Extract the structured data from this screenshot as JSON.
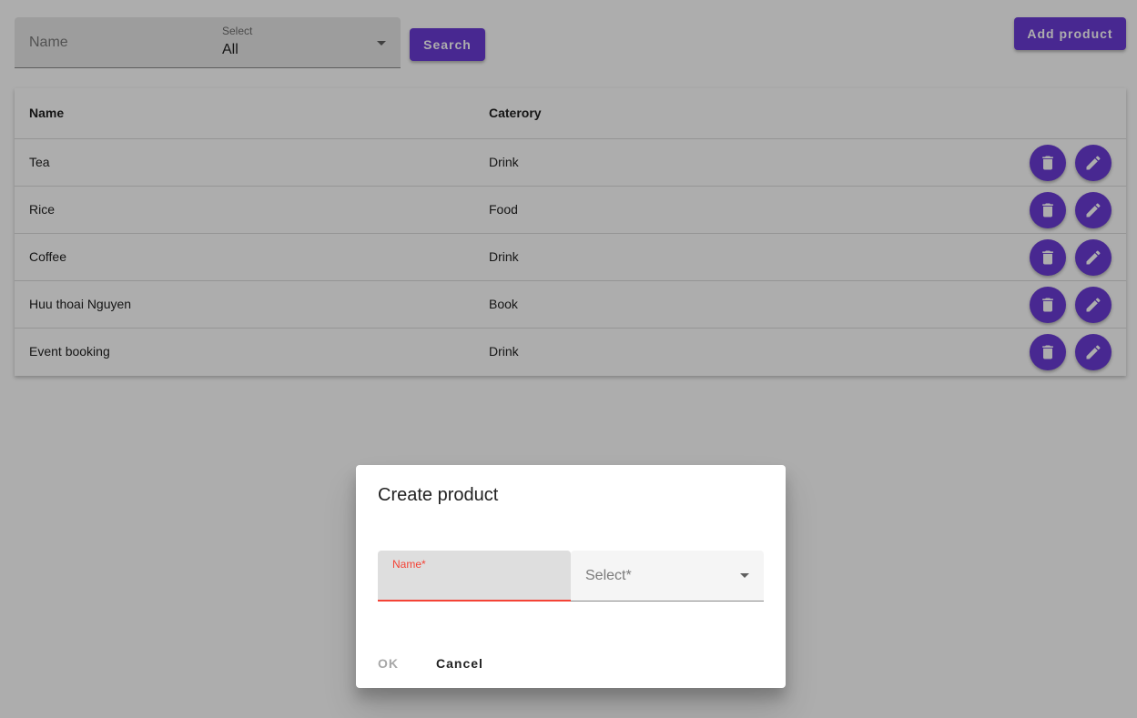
{
  "filters": {
    "name_placeholder": "Name",
    "select_label": "Select",
    "select_value": "All",
    "search_label": "Search"
  },
  "add_product_label": "Add product",
  "table": {
    "headers": {
      "name": "Name",
      "category": "Caterory"
    },
    "rows": [
      {
        "name": "Tea",
        "category": "Drink"
      },
      {
        "name": "Rice",
        "category": "Food"
      },
      {
        "name": "Coffee",
        "category": "Drink"
      },
      {
        "name": "Huu thoai Nguyen",
        "category": "Book"
      },
      {
        "name": "Event booking",
        "category": "Drink"
      }
    ]
  },
  "dialog": {
    "title": "Create product",
    "name_label": "Name*",
    "name_value": "",
    "select_placeholder": "Select*",
    "ok_label": "OK",
    "cancel_label": "Cancel"
  },
  "colors": {
    "primary": "#6a3bd6",
    "error": "#f44336",
    "icon_delete": "trash-icon",
    "icon_edit": "pencil-icon"
  }
}
